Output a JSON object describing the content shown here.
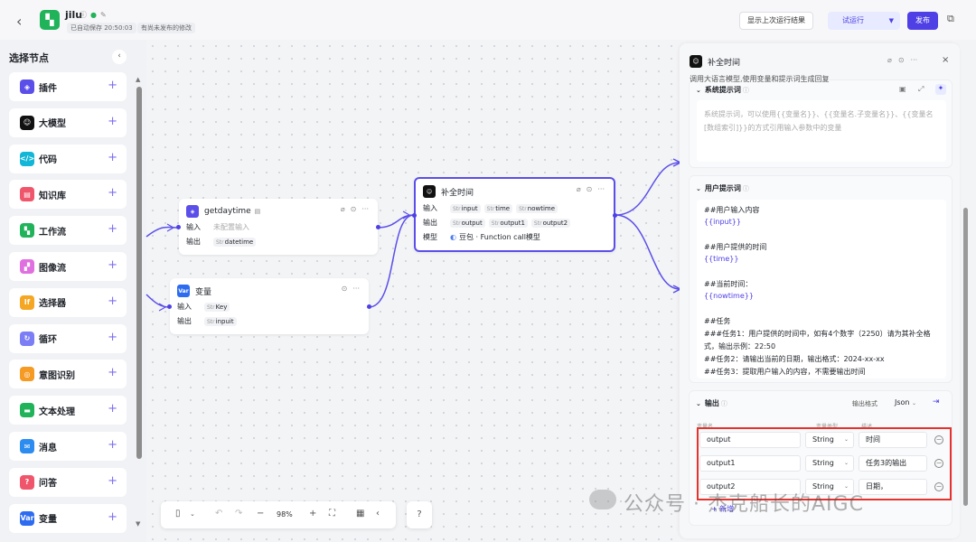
{
  "topbar": {
    "app_name": "jilu",
    "autosave": "已自动保存 20:50:03",
    "unpublished": "有尚未发布的修改",
    "last_run": "显示上次运行结果",
    "trial_run": "试运行",
    "publish": "发布"
  },
  "sidebar": {
    "title": "选择节点",
    "items": [
      {
        "label": "插件",
        "icon": "plugin-icon",
        "color": "#5b4fe9"
      },
      {
        "label": "大模型",
        "icon": "llm-icon",
        "color": "#111111"
      },
      {
        "label": "代码",
        "icon": "code-icon",
        "color": "#12b6d6"
      },
      {
        "label": "知识库",
        "icon": "knowledge-icon",
        "color": "#f0566b"
      },
      {
        "label": "工作流",
        "icon": "workflow-icon",
        "color": "#21b35a"
      },
      {
        "label": "图像流",
        "icon": "image-flow-icon",
        "color": "#e070e0"
      },
      {
        "label": "选择器",
        "icon": "selector-icon",
        "color": "#f5a623"
      },
      {
        "label": "循环",
        "icon": "loop-icon",
        "color": "#7b7ef5"
      },
      {
        "label": "意图识别",
        "icon": "intent-icon",
        "color": "#f59a23"
      },
      {
        "label": "文本处理",
        "icon": "text-process-icon",
        "color": "#21b35a"
      },
      {
        "label": "消息",
        "icon": "message-icon",
        "color": "#2d8cf0"
      },
      {
        "label": "问答",
        "icon": "qa-icon",
        "color": "#f0566b"
      },
      {
        "label": "变量",
        "icon": "variable-icon",
        "color": "#2d6cf0",
        "glyph": "Var"
      }
    ]
  },
  "nodes": {
    "getdaytime": {
      "title": "getdaytime",
      "input_label": "输入",
      "input_placeholder": "未配置输入",
      "output_label": "输出",
      "output_tag": "datetime"
    },
    "variable": {
      "title": "变量",
      "icon_text": "Var",
      "input_label": "输入",
      "input_tag": "Key",
      "output_label": "输出",
      "output_tag": "inpuit"
    },
    "llm": {
      "title": "补全时间",
      "input_label": "输入",
      "inputs": [
        "input",
        "time",
        "nowtime"
      ],
      "output_label": "输出",
      "outputs": [
        "output",
        "output1",
        "output2"
      ],
      "model_label": "模型",
      "model": "豆包 · Function call模型"
    },
    "str_prefix": "Str"
  },
  "zoom": {
    "level": "98%"
  },
  "panel": {
    "title": "补全时间",
    "description": "调用大语言模型,使用变量和提示词生成回复",
    "system": {
      "title": "系统提示词",
      "placeholder": "系统提示词，可以使用{{变量名}}、{{变量名.子变量名}}、{{变量名[数组索引]}}的方式引用输入参数中的变量"
    },
    "user": {
      "title": "用户提示词",
      "lines": [
        {
          "text": "##用户输入内容",
          "var": false
        },
        {
          "text": "{{input}}",
          "var": true
        },
        {
          "text": "##用户提供的时间",
          "var": false
        },
        {
          "text": "{{time}}",
          "var": true
        },
        {
          "text": "##当前时间：",
          "var": false
        },
        {
          "text": "{{nowtime}}",
          "var": true
        },
        {
          "text": "##任务",
          "var": false
        },
        {
          "text": "###任务1：用户提供的时间中，如有4个数字（2250）请为其补全格",
          "var": false
        },
        {
          "text": "式，输出示例：22:50",
          "var": false
        },
        {
          "text": "##任务2：请输出当前的日期，输出格式：2024-xx-xx",
          "var": false
        },
        {
          "text": "##任务3：提取用户输入的内容，不需要输出时间",
          "var": false
        }
      ]
    },
    "output": {
      "title": "输出",
      "format_label": "输出格式",
      "format_value": "Json",
      "col_name": "变量名",
      "col_type": "变量类型",
      "col_desc": "描述",
      "rows": [
        {
          "name": "output",
          "type": "String",
          "desc": "时间"
        },
        {
          "name": "output1",
          "type": "String",
          "desc": "任务3的输出"
        },
        {
          "name": "output2",
          "type": "String",
          "desc": "日期，"
        }
      ],
      "add_label": "新增"
    }
  },
  "watermark": "公众号 · 杰克船长的AIGC"
}
